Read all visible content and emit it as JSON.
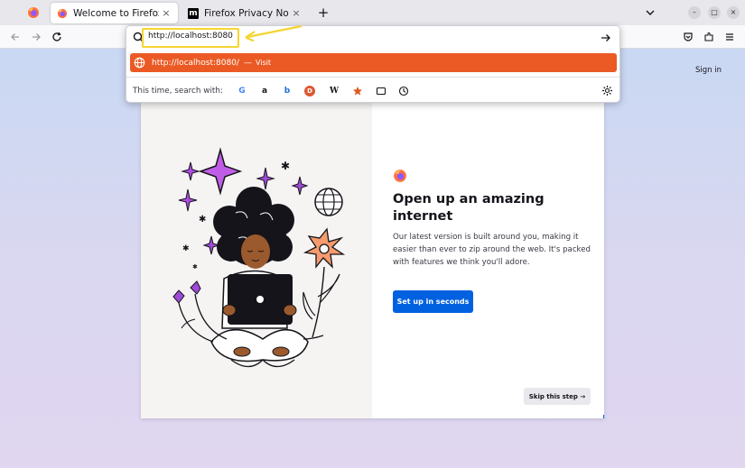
{
  "tabs": [
    {
      "title": "Welcome to Firefox",
      "active": true
    },
    {
      "title": "Firefox Privacy Notice —",
      "favicon_letter": "m",
      "active": false
    }
  ],
  "window_controls": {
    "minimize": "–",
    "maximize": "□",
    "close": "×"
  },
  "tab_close": "×",
  "newtab": "+",
  "url_bar": {
    "value": "http://localhost:8080"
  },
  "suggestion": {
    "url": "http://localhost:8080/",
    "separator": "—",
    "action": "Visit"
  },
  "search_with": {
    "label": "This time, search with:",
    "engines": [
      "G",
      "a",
      "b",
      "D",
      "W"
    ]
  },
  "page": {
    "signin": "Sign in",
    "headline": "Open up an amazing internet",
    "body": "Our latest version is built around you, making it easier than ever to zip around the web. It's packed with features we think you'll adore.",
    "primary_button": "Set up in seconds",
    "skip_button": "Skip this step →",
    "progress": 0.2
  },
  "colors": {
    "accent": "#0061e0",
    "suggestion_bg": "#eb5a25",
    "highlight": "#f6d531",
    "annotation": "#f6d531"
  }
}
